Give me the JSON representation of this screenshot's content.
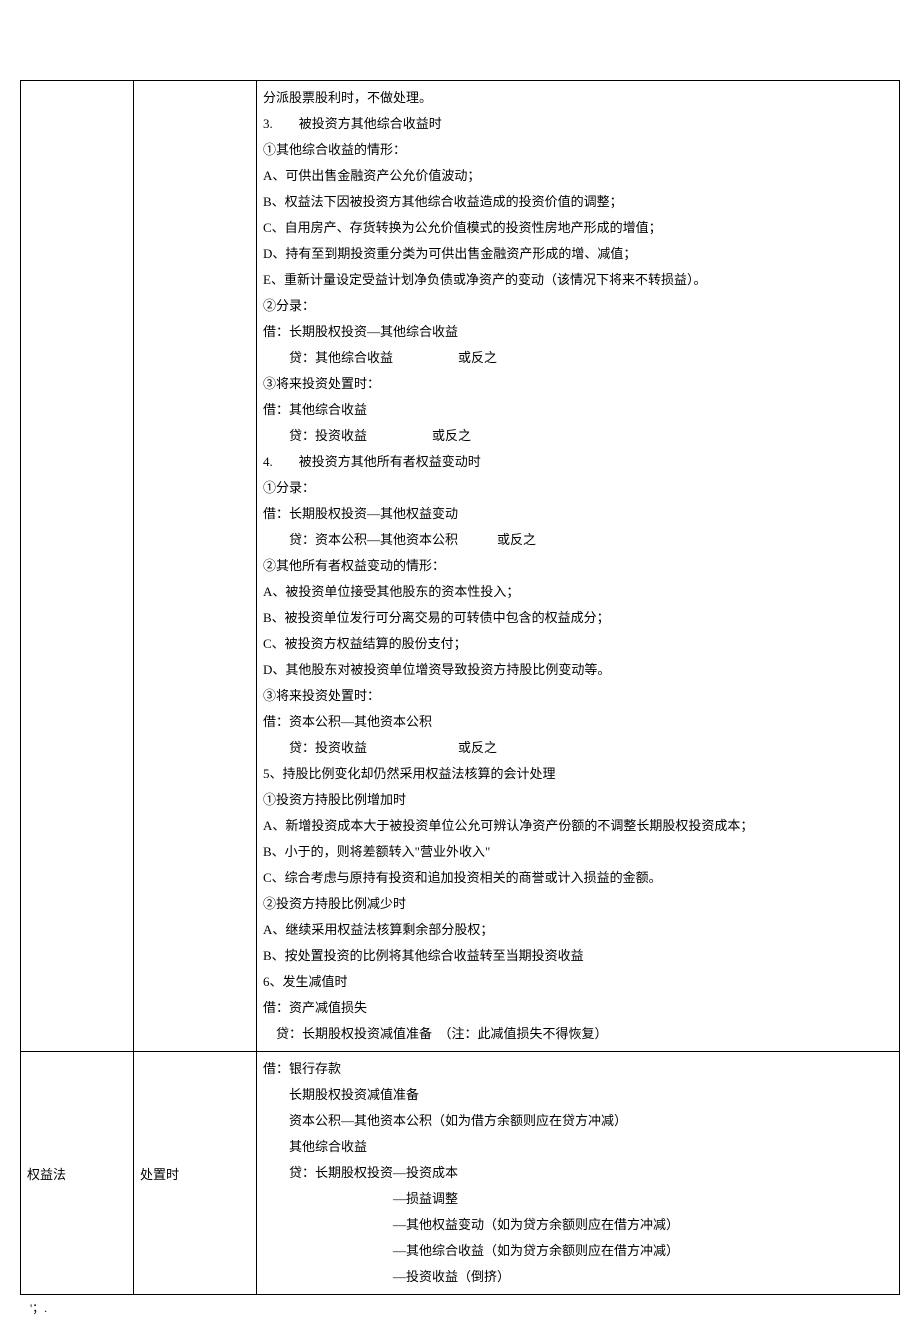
{
  "row1": {
    "colA": "",
    "colB": "",
    "lines": [
      "分派股票股利时，不做处理。",
      "3.　　被投资方其他综合收益时",
      "①其他综合收益的情形：",
      "A、可供出售金融资产公允价值波动；",
      "B、权益法下因被投资方其他综合收益造成的投资价值的调整；",
      "C、自用房产、存货转换为公允价值模式的投资性房地产形成的增值；",
      "D、持有至到期投资重分类为可供出售金融资产形成的增、减值；",
      "E、重新计量设定受益计划净负债或净资产的变动（该情况下将来不转损益）。",
      "②分录：",
      "借：长期股权投资—其他综合收益",
      "　　贷：其他综合收益　　　　　或反之",
      "③将来投资处置时：",
      "借：其他综合收益",
      "　　贷：投资收益　　　　　或反之",
      "4.　　被投资方其他所有者权益变动时",
      "①分录：",
      "借：长期股权投资—其他权益变动",
      "　　贷：资本公积—其他资本公积　　　或反之",
      "②其他所有者权益变动的情形：",
      "A、被投资单位接受其他股东的资本性投入；",
      "B、被投资单位发行可分离交易的可转债中包含的权益成分；",
      "C、被投资方权益结算的股份支付；",
      "D、其他股东对被投资单位增资导致投资方持股比例变动等。",
      "③将来投资处置时：",
      "借：资本公积—其他资本公积",
      "　　贷：投资收益　　　　　　　或反之",
      "5、持股比例变化却仍然采用权益法核算的会计处理",
      "①投资方持股比例增加时",
      "A、新增投资成本大于被投资单位公允可辨认净资产份额的不调整长期股权投资成本；",
      "B、小于的，则将差额转入\"营业外收入\"",
      "C、综合考虑与原持有投资和追加投资相关的商誉或计入损益的金额。",
      "②投资方持股比例减少时",
      "A、继续采用权益法核算剩余部分股权；",
      "B、按处置投资的比例将其他综合收益转至当期投资收益",
      "6、发生减值时",
      "借：资产减值损失",
      "　贷：长期股权投资减值准备　（注：此减值损失不得恢复）"
    ]
  },
  "row2": {
    "colA": "权益法",
    "colB": "处置时",
    "lines": [
      "借：银行存款",
      "　　长期股权投资减值准备",
      "　　资本公积—其他资本公积（如为借方余额则应在贷方冲减）",
      "　　其他综合收益",
      "　　贷：长期股权投资—投资成本",
      "　　　　　　　　　　—损益调整",
      "　　　　　　　　　　—其他权益变动（如为贷方余额则应在借方冲减）",
      "　　　　　　　　　　—其他综合收益（如为贷方余额则应在借方冲减）",
      "　　　　　　　　　　—投资收益（倒挤）"
    ]
  },
  "footnote": "'；."
}
